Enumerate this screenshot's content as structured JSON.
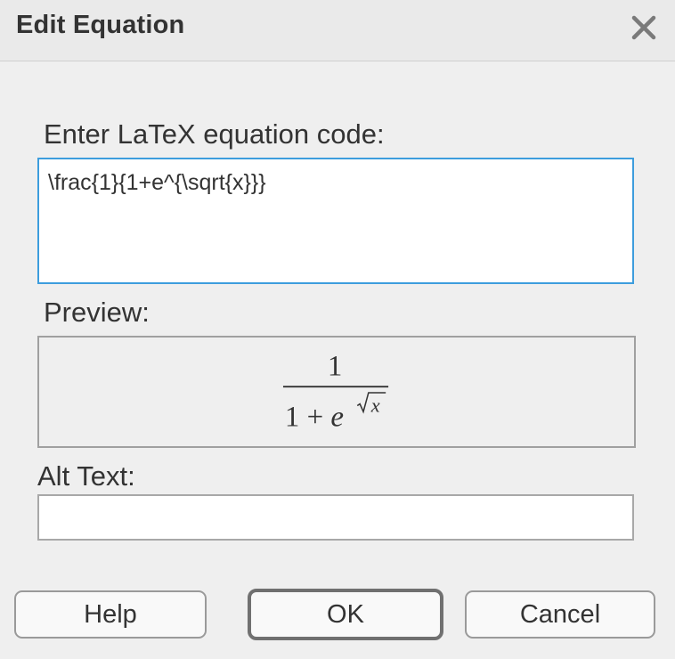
{
  "dialog": {
    "title": "Edit Equation",
    "close_icon": "close-x-icon"
  },
  "code": {
    "label": "Enter LaTeX equation code:",
    "value": "\\frac{1}{1+e^{\\sqrt{x}}}"
  },
  "preview": {
    "label": "Preview:",
    "numerator": "1",
    "denominator_base": "1 + e",
    "exponent_var": "x"
  },
  "alt_text": {
    "label": "Alt Text:",
    "value": ""
  },
  "buttons": {
    "help": "Help",
    "ok": "OK",
    "cancel": "Cancel"
  },
  "colors": {
    "focus_border": "#3d9ddd",
    "background": "#efefef"
  }
}
